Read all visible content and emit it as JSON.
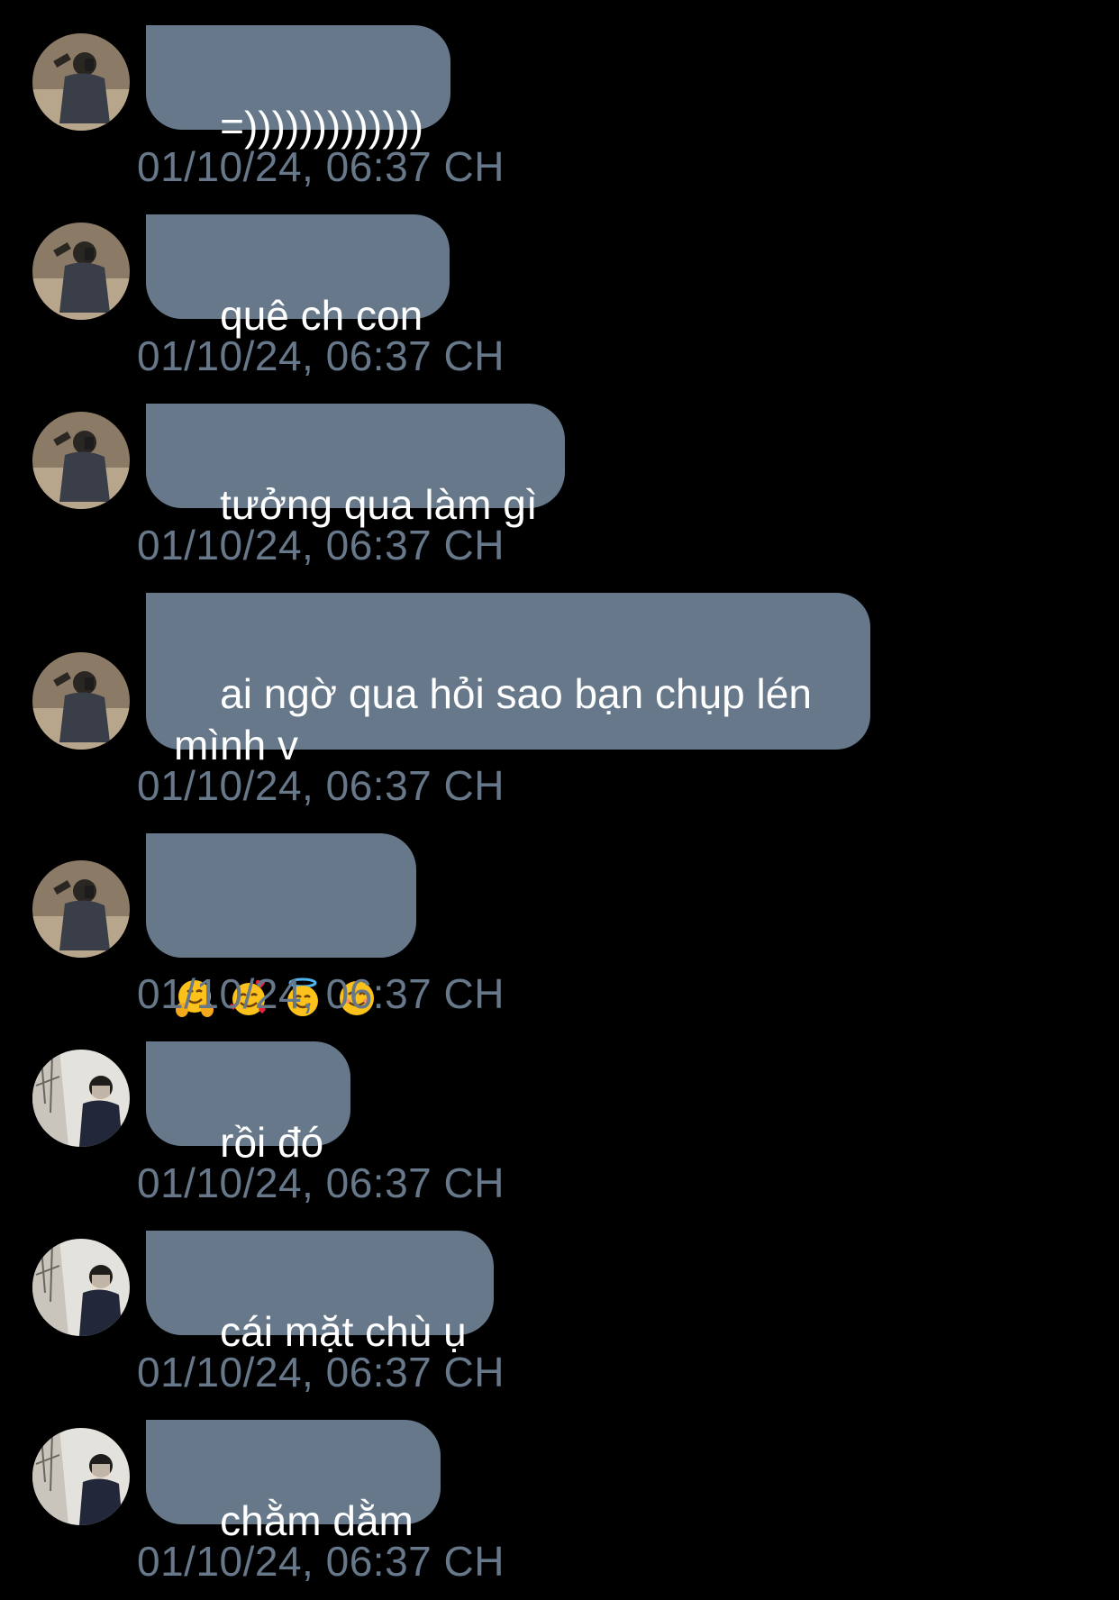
{
  "messages": [
    {
      "text": "=)))))))))))))",
      "time": "01/10/24, 06:37 CH",
      "avatar": "avatar-a"
    },
    {
      "text": "quê ch con",
      "time": "01/10/24, 06:37 CH",
      "avatar": "avatar-a"
    },
    {
      "text": "tưởng qua làm gì",
      "time": "01/10/24, 06:37 CH",
      "avatar": "avatar-a"
    },
    {
      "text": "ai ngờ qua hỏi sao bạn chụp lén\nmình v",
      "time": "01/10/24, 06:37 CH",
      "avatar": "avatar-a"
    },
    {
      "emojis": [
        "hugging-face-emoji",
        "smiling-face-with-hearts-emoji",
        "smiling-face-with-halo-emoji",
        "smiling-face-with-smiling-eyes-emoji"
      ],
      "time": "01/10/24, 06:37 CH",
      "avatar": "avatar-a"
    },
    {
      "text": "rồi đó",
      "time": "01/10/24, 06:37 CH",
      "avatar": "avatar-b"
    },
    {
      "text": "cái mặt chù ụ",
      "time": "01/10/24, 06:37 CH",
      "avatar": "avatar-b"
    },
    {
      "text": "chằm dằm",
      "time": "01/10/24, 06:37 CH",
      "avatar": "avatar-b"
    }
  ],
  "colors": {
    "background": "#000000",
    "bubble": "#66788a",
    "bubble_text": "#ffffff",
    "timestamp": "#66788a"
  }
}
